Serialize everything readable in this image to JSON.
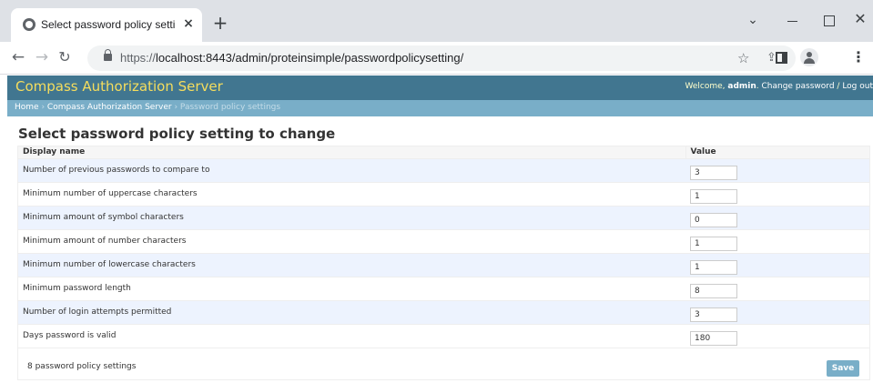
{
  "browser": {
    "tab_title": "Select password policy setting to",
    "tab_close_glyph": "×",
    "new_tab_glyph": "+",
    "url_scheme": "https://",
    "url_rest": "localhost:8443/admin/proteinsimple/passwordpolicysetting/",
    "window_controls": {
      "chevron": "⌄",
      "close": "✕"
    },
    "icons": [
      "back-arrow-icon",
      "forward-arrow-icon",
      "reload-icon",
      "lock-icon",
      "share-icon",
      "star-icon",
      "side-panel-icon",
      "profile-icon",
      "menu-icon"
    ]
  },
  "header": {
    "site_name": "Compass Authorization Server",
    "welcome": "Welcome, ",
    "username": "admin",
    "welcome_suffix": ". ",
    "change_password": "Change password",
    "separator": " / ",
    "logout": "Log out",
    "colors": {
      "header_bg": "#417690",
      "branding": "#f5dd5d",
      "breadcrumbs_bg": "#79aec8"
    }
  },
  "breadcrumbs": {
    "home": "Home",
    "sep": " › ",
    "app": "Compass Authorization Server",
    "current": "Password policy settings"
  },
  "page_title": "Select password policy setting to change",
  "table": {
    "headers": {
      "display_name": "Display name",
      "value": "Value"
    },
    "rows": [
      {
        "name": "Number of previous passwords to compare to",
        "value": "3"
      },
      {
        "name": "Minimum number of uppercase characters",
        "value": "1"
      },
      {
        "name": "Minimum amount of symbol characters",
        "value": "0"
      },
      {
        "name": "Minimum amount of number characters",
        "value": "1"
      },
      {
        "name": "Minimum number of lowercase characters",
        "value": "1"
      },
      {
        "name": "Minimum password length",
        "value": "8"
      },
      {
        "name": "Number of login attempts permitted",
        "value": "3"
      },
      {
        "name": "Days password is valid",
        "value": "180"
      }
    ]
  },
  "footer": {
    "count_text": "8 password policy settings",
    "save_label": "Save"
  }
}
